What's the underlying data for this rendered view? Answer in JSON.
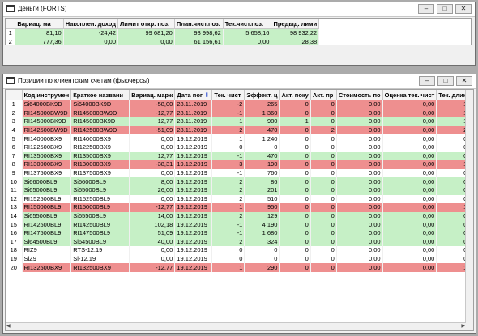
{
  "window1": {
    "title": "Деньги (FORTS)",
    "columns": [
      "Вариац. ма",
      "Накоплен. доход",
      "Лимит откр. поз.",
      "План.чист.поз.",
      "Тек.чист.поз.",
      "Предыд. лими"
    ],
    "rows": [
      {
        "idx": "1",
        "color": "green",
        "cells": [
          "81,10",
          "-24,42",
          "99 681,20",
          "93 998,62",
          "5 658,16",
          "98 932,22"
        ]
      },
      {
        "idx": "2",
        "color": "green",
        "cells": [
          "777,36",
          "0,00",
          "0,00",
          "61 156,61",
          "0,00",
          "28,38"
        ]
      }
    ]
  },
  "window2": {
    "title": "Позиции по клиентским счетам (фьючерсы)",
    "sort_icon": "sort-arrow-down-icon",
    "columns": [
      "Код инструмен",
      "Краткое названи",
      "Вариац. марж",
      "Дата пог",
      "Тек. чист",
      "Эффект. ц",
      "Акт. поку",
      "Акт. пр",
      "Стоимость по",
      "Оценка тек. чист",
      "Тек. длин"
    ],
    "rows": [
      {
        "idx": "1",
        "color": "red",
        "cells": [
          "Si64000BK9D",
          "Si64000BK9D",
          "-58,00",
          "28.11.2019",
          "-2",
          "265",
          "0",
          "0",
          "0,00",
          "0,00",
          "1"
        ]
      },
      {
        "idx": "2",
        "color": "red",
        "cells": [
          "RI145000BW9D",
          "RI145000BW9D",
          "-12,77",
          "28.11.2019",
          "-1",
          "1 360",
          "0",
          "0",
          "0,00",
          "0,00",
          "1"
        ]
      },
      {
        "idx": "3",
        "color": "green",
        "cells": [
          "RI145000BK9D",
          "RI145000BK9D",
          "12,77",
          "28.11.2019",
          "1",
          "980",
          "1",
          "0",
          "0,00",
          "0,00",
          "1"
        ]
      },
      {
        "idx": "4",
        "color": "red",
        "cells": [
          "RI142500BW9D",
          "RI142500BW9D",
          "-51,09",
          "28.11.2019",
          "2",
          "470",
          "0",
          "2",
          "0,00",
          "0,00",
          "2"
        ]
      },
      {
        "idx": "5",
        "color": "white",
        "cells": [
          "RI140000BX9",
          "RI140000BX9",
          "0,00",
          "19.12.2019",
          "1",
          "1 240",
          "0",
          "0",
          "0,00",
          "0,00",
          "0"
        ]
      },
      {
        "idx": "6",
        "color": "white",
        "cells": [
          "RI122500BX9",
          "RI122500BX9",
          "0,00",
          "19.12.2019",
          "0",
          "0",
          "0",
          "0",
          "0,00",
          "0,00",
          "0"
        ]
      },
      {
        "idx": "7",
        "color": "green",
        "cells": [
          "RI135000BX9",
          "RI135000BX9",
          "12,77",
          "19.12.2019",
          "-1",
          "470",
          "0",
          "0",
          "0,00",
          "0,00",
          "0"
        ]
      },
      {
        "idx": "8",
        "color": "red",
        "cells": [
          "RI130000BX9",
          "RI130000BX9",
          "-38,31",
          "19.12.2019",
          "3",
          "190",
          "0",
          "0",
          "0,00",
          "0,00",
          "1"
        ]
      },
      {
        "idx": "9",
        "color": "white",
        "cells": [
          "RI137500BX9",
          "RI137500BX9",
          "0,00",
          "19.12.2019",
          "-1",
          "760",
          "0",
          "0",
          "0,00",
          "0,00",
          "0"
        ]
      },
      {
        "idx": "10",
        "color": "green",
        "cells": [
          "Si66000BL9",
          "Si66000BL9",
          "8,00",
          "19.12.2019",
          "2",
          "86",
          "0",
          "0",
          "0,00",
          "0,00",
          "0"
        ]
      },
      {
        "idx": "11",
        "color": "green",
        "cells": [
          "Si65000BL9",
          "Si65000BL9",
          "26,00",
          "19.12.2019",
          "2",
          "201",
          "0",
          "0",
          "0,00",
          "0,00",
          "0"
        ]
      },
      {
        "idx": "12",
        "color": "white",
        "cells": [
          "RI152500BL9",
          "RI152500BL9",
          "0,00",
          "19.12.2019",
          "2",
          "510",
          "0",
          "0",
          "0,00",
          "0,00",
          "0"
        ]
      },
      {
        "idx": "13",
        "color": "red",
        "cells": [
          "RI150000BL9",
          "RI150000BL9",
          "-12,77",
          "19.12.2019",
          "1",
          "950",
          "0",
          "0",
          "0,00",
          "0,00",
          "1"
        ]
      },
      {
        "idx": "14",
        "color": "green",
        "cells": [
          "Si65500BL9",
          "Si65500BL9",
          "14,00",
          "19.12.2019",
          "2",
          "129",
          "0",
          "0",
          "0,00",
          "0,00",
          "0"
        ]
      },
      {
        "idx": "15",
        "color": "green",
        "cells": [
          "RI142500BL9",
          "RI142500BL9",
          "102,18",
          "19.12.2019",
          "-1",
          "4 190",
          "0",
          "0",
          "0,00",
          "0,00",
          "0"
        ]
      },
      {
        "idx": "16",
        "color": "green",
        "cells": [
          "RI147500BL9",
          "RI147500BL9",
          "51,09",
          "19.12.2019",
          "-1",
          "1 680",
          "0",
          "0",
          "0,00",
          "0,00",
          "0"
        ]
      },
      {
        "idx": "17",
        "color": "green",
        "cells": [
          "Si64500BL9",
          "Si64500BL9",
          "40,00",
          "19.12.2019",
          "2",
          "324",
          "0",
          "0",
          "0,00",
          "0,00",
          "0"
        ]
      },
      {
        "idx": "18",
        "color": "white",
        "cells": [
          "RIZ9",
          "RTS-12.19",
          "0,00",
          "19.12.2019",
          "0",
          "0",
          "0",
          "0",
          "0,00",
          "0,00",
          "0"
        ]
      },
      {
        "idx": "19",
        "color": "white",
        "cells": [
          "SiZ9",
          "Si-12.19",
          "0,00",
          "19.12.2019",
          "0",
          "0",
          "0",
          "0",
          "0,00",
          "0,00",
          "0"
        ]
      },
      {
        "idx": "20",
        "color": "red",
        "cells": [
          "RI132500BX9",
          "RI132500BX9",
          "-12,77",
          "19.12.2019",
          "1",
          "290",
          "0",
          "0",
          "0,00",
          "0,00",
          "1"
        ]
      }
    ]
  },
  "controls": {
    "minimize": "–",
    "maximize": "□",
    "close": "✕"
  }
}
